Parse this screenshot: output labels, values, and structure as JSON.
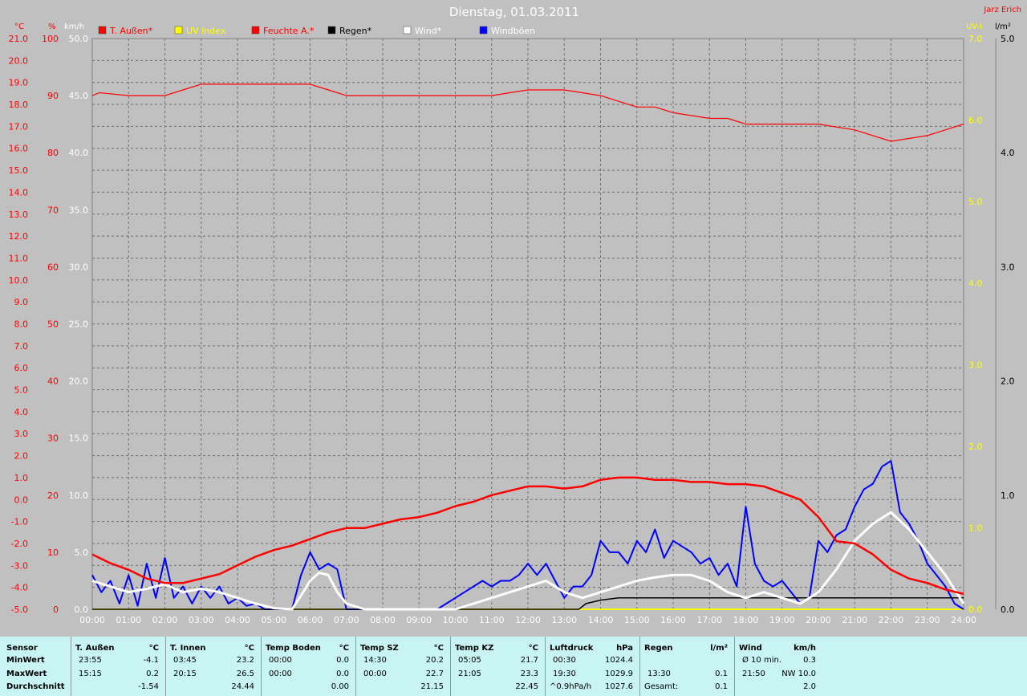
{
  "title": "Dienstag, 01.03.2011",
  "author": "Jarz Erich",
  "colors": {
    "red": "#ff0000",
    "darkred": "#dd0000",
    "yellow": "#ffff00",
    "black": "#000000",
    "white": "#ffffff",
    "blue": "#0000ff",
    "bg": "#c0c0c0",
    "grid": "#707070",
    "stats_bg": "#c8f4f4"
  },
  "axis_units": {
    "temp": "°C",
    "hum": "%",
    "wind": "km/h",
    "uv": "UV-I",
    "rain": "l/m²"
  },
  "axis_ticks": {
    "temp": [
      "21.0",
      "20.0",
      "19.0",
      "18.0",
      "17.0",
      "16.0",
      "15.0",
      "14.0",
      "13.0",
      "12.0",
      "11.0",
      "10.0",
      "9.0",
      "8.0",
      "7.0",
      "6.0",
      "5.0",
      "4.0",
      "3.0",
      "2.0",
      "1.0",
      "0.0",
      "-1.0",
      "-2.0",
      "-3.0",
      "-4.0",
      "-5.0"
    ],
    "hum": [
      "100",
      "90",
      "80",
      "70",
      "60",
      "50",
      "40",
      "30",
      "20",
      "10",
      "0"
    ],
    "wind": [
      "50.0",
      "45.0",
      "40.0",
      "35.0",
      "30.0",
      "25.0",
      "20.0",
      "15.0",
      "10.0",
      "5.0",
      "0.0"
    ],
    "uv": [
      "7.0",
      "6.0",
      "5.0",
      "4.0",
      "3.0",
      "2.0",
      "1.0",
      "0.0"
    ],
    "rain": [
      "5.0",
      "4.0",
      "3.0",
      "2.0",
      "1.0",
      "0.0"
    ],
    "time": [
      "00:00",
      "01:00",
      "02:00",
      "03:00",
      "04:00",
      "05:00",
      "06:00",
      "07:00",
      "08:00",
      "09:00",
      "10:00",
      "11:00",
      "12:00",
      "13:00",
      "14:00",
      "15:00",
      "16:00",
      "17:00",
      "18:00",
      "19:00",
      "20:00",
      "21:00",
      "22:00",
      "23:00",
      "24:00"
    ]
  },
  "chart_data": {
    "type": "line",
    "title": "Dienstag, 01.03.2011",
    "x_unit": "hours",
    "xlim": [
      0,
      24
    ],
    "ylim_temp": [
      -5,
      21
    ],
    "ylim_hum": [
      0,
      100
    ],
    "ylim_wind": [
      0,
      50
    ],
    "ylim_uv": [
      0,
      7
    ],
    "ylim_rain": [
      0,
      5
    ],
    "grid": true,
    "legend_position": "top",
    "series": [
      {
        "name": "T. Außen*",
        "color": "#ff0000",
        "axis": "temp",
        "x": [
          0,
          0.5,
          1,
          1.5,
          2,
          2.5,
          3,
          3.5,
          4,
          4.5,
          5,
          5.5,
          6,
          6.5,
          7,
          7.5,
          8,
          8.5,
          9,
          9.5,
          10,
          10.5,
          11,
          11.5,
          12,
          12.5,
          13,
          13.5,
          14,
          14.5,
          15,
          15.5,
          16,
          16.5,
          17,
          17.5,
          18,
          18.5,
          19,
          19.5,
          20,
          20.5,
          21,
          21.5,
          22,
          22.5,
          23,
          23.5,
          24
        ],
        "values": [
          -2.5,
          -2.9,
          -3.2,
          -3.6,
          -3.8,
          -3.8,
          -3.6,
          -3.4,
          -3.0,
          -2.6,
          -2.3,
          -2.1,
          -1.8,
          -1.5,
          -1.3,
          -1.3,
          -1.1,
          -0.9,
          -0.8,
          -0.6,
          -0.3,
          -0.1,
          0.2,
          0.4,
          0.6,
          0.6,
          0.5,
          0.6,
          0.9,
          1.0,
          1.0,
          0.9,
          0.9,
          0.8,
          0.8,
          0.7,
          0.7,
          0.6,
          0.3,
          0.0,
          -0.8,
          -1.9,
          -2.0,
          -2.5,
          -3.2,
          -3.6,
          -3.8,
          -4.1,
          -4.3
        ]
      },
      {
        "name": "Feuchte A.*",
        "color": "#ff0000",
        "axis": "hum",
        "x": [
          0,
          0.2,
          1,
          2,
          2.5,
          3,
          4,
          5,
          6,
          6.5,
          7,
          8,
          9,
          10,
          11,
          11.5,
          12,
          13,
          14,
          15,
          15.5,
          16,
          17,
          17.5,
          18,
          19,
          19.5,
          20,
          21,
          21.5,
          22,
          23,
          24
        ],
        "values": [
          90,
          90.5,
          90,
          90,
          91,
          92,
          92,
          92,
          92,
          91,
          90,
          90,
          90,
          90,
          90,
          90.5,
          91,
          91,
          90,
          88,
          88,
          87,
          86,
          86,
          85,
          85,
          85,
          85,
          84,
          83,
          82,
          83,
          85
        ]
      },
      {
        "name": "UV Index",
        "color": "#ffff00",
        "axis": "uv",
        "x": [
          0,
          24
        ],
        "values": [
          0.0,
          0.0
        ]
      },
      {
        "name": "Regen*",
        "color": "#000000",
        "axis": "rain",
        "x": [
          0,
          13.4,
          13.6,
          14,
          14.5,
          15,
          24
        ],
        "values": [
          0,
          0,
          0.05,
          0.08,
          0.1,
          0.1,
          0.1
        ]
      },
      {
        "name": "Wind*",
        "color": "#ffffff",
        "axis": "wind",
        "x": [
          0,
          0.5,
          1,
          1.5,
          2,
          2.5,
          3,
          3.5,
          4,
          4.5,
          5,
          5.5,
          5.75,
          6,
          6.25,
          6.5,
          6.75,
          7,
          7.5,
          8,
          9,
          10,
          10.5,
          11,
          11.5,
          12,
          12.5,
          13,
          13.5,
          14,
          14.5,
          15,
          15.5,
          16,
          16.5,
          17,
          17.5,
          18,
          18.5,
          19,
          19.5,
          20,
          20.5,
          21,
          21.5,
          22,
          22.5,
          23,
          23.5,
          24
        ],
        "values": [
          2.5,
          2.0,
          1.5,
          1.8,
          2.2,
          1.5,
          1.8,
          1.5,
          1.0,
          0.5,
          0.1,
          0.0,
          1.2,
          2.5,
          3.2,
          3.0,
          1.5,
          0.5,
          0.0,
          0.0,
          0.0,
          0.0,
          0.5,
          1.0,
          1.5,
          2.0,
          2.5,
          1.5,
          1.0,
          1.5,
          2.0,
          2.5,
          2.8,
          3.0,
          3.0,
          2.5,
          1.5,
          1.0,
          1.5,
          1.0,
          0.5,
          1.5,
          3.5,
          6.0,
          7.5,
          8.5,
          7.0,
          5.0,
          3.0,
          0.5
        ]
      },
      {
        "name": "Windböen",
        "color": "#0000ff",
        "axis": "wind",
        "x": [
          0,
          0.25,
          0.5,
          0.75,
          1,
          1.25,
          1.5,
          1.75,
          2,
          2.25,
          2.5,
          2.75,
          3,
          3.25,
          3.5,
          3.75,
          4,
          4.25,
          4.5,
          4.75,
          5,
          5.25,
          5.5,
          5.75,
          6,
          6.25,
          6.5,
          6.75,
          7,
          7.5,
          8,
          8.5,
          9,
          9.5,
          10,
          10.25,
          10.5,
          10.75,
          11,
          11.25,
          11.5,
          11.75,
          12,
          12.25,
          12.5,
          12.75,
          13,
          13.25,
          13.5,
          13.75,
          14,
          14.25,
          14.5,
          14.75,
          15,
          15.25,
          15.5,
          15.75,
          16,
          16.25,
          16.5,
          16.75,
          17,
          17.25,
          17.5,
          17.75,
          18,
          18.25,
          18.5,
          18.75,
          19,
          19.25,
          19.5,
          19.75,
          20,
          20.25,
          20.5,
          20.75,
          21,
          21.25,
          21.5,
          21.75,
          22,
          22.25,
          22.5,
          22.75,
          23,
          23.25,
          23.5,
          23.75,
          24
        ],
        "values": [
          3,
          1.5,
          2.5,
          0.5,
          3,
          0.3,
          4,
          1,
          4.5,
          1,
          2,
          0.5,
          2,
          1,
          2,
          0.5,
          1,
          0.3,
          0.5,
          0,
          0,
          0,
          0,
          3,
          5,
          3.5,
          4,
          3.5,
          0,
          0,
          0,
          0,
          0,
          0,
          1,
          1.5,
          2,
          2.5,
          2,
          2.5,
          2.5,
          3,
          4,
          3,
          4,
          2.5,
          1,
          2,
          2,
          3,
          6,
          5,
          5,
          4,
          6,
          5,
          7,
          4.5,
          6,
          5.5,
          5,
          4,
          4.5,
          3,
          4,
          2,
          9,
          4,
          2.5,
          2,
          2.5,
          1.5,
          0.5,
          1,
          6,
          5,
          6.5,
          7,
          9,
          10.5,
          11,
          12.5,
          13,
          8.5,
          7.5,
          6,
          4,
          3,
          2,
          0.5,
          0
        ]
      }
    ]
  },
  "legend": [
    {
      "label": "T. Außen*",
      "color": "#ff0000",
      "text_color": "#ff0000"
    },
    {
      "label": "UV Index",
      "color": "#ffff00",
      "text_color": "#ffff00"
    },
    {
      "label": "Feuchte A.*",
      "color": "#ff0000",
      "text_color": "#ff0000"
    },
    {
      "label": "Regen*",
      "color": "#000000",
      "text_color": "#000000"
    },
    {
      "label": "Wind*",
      "color": "#ffffff",
      "text_color": "#ffffff"
    },
    {
      "label": "Windböen",
      "color": "#0000ff",
      "text_color": "#ffffff"
    }
  ],
  "stats": {
    "sensor": {
      "header": "Sensor",
      "rows": [
        "MinWert",
        "MaxWert",
        "Durchschnitt"
      ]
    },
    "columns": [
      {
        "name": "T. Außen",
        "unit": "°C",
        "min_time": "23:55",
        "min_val": "-4.1",
        "max_time": "15:15",
        "max_val": "0.2",
        "avg": "-1.54"
      },
      {
        "name": "T. Innen",
        "unit": "°C",
        "min_time": "03:45",
        "min_val": "23.2",
        "max_time": "20:15",
        "max_val": "26.5",
        "avg": "24.44"
      },
      {
        "name": "Temp Boden",
        "unit": "°C",
        "min_time": "00:00",
        "min_val": "0.0",
        "max_time": "00:00",
        "max_val": "0.0",
        "avg": "0.00"
      },
      {
        "name": "Temp SZ",
        "unit": "°C",
        "min_time": "14:30",
        "min_val": "20.2",
        "max_time": "00:00",
        "max_val": "22.7",
        "avg": "21.15"
      },
      {
        "name": "Temp KZ",
        "unit": "°C",
        "min_time": "05:05",
        "min_val": "21.7",
        "max_time": "21:05",
        "max_val": "23.3",
        "avg": "22.45"
      },
      {
        "name": "Luftdruck",
        "unit": "hPa",
        "min_time": "00:30",
        "min_val": "1024.4",
        "max_time": "19:30",
        "max_val": "1029.9",
        "avg_label": "^0.9hPa/h",
        "avg": "1027.6"
      },
      {
        "name": "Regen",
        "unit": "l/m²",
        "min_time": "",
        "min_val": "",
        "max_time": "13:30",
        "max_val": "0.1",
        "avg_label": "Gesamt:",
        "avg": "0.1"
      },
      {
        "name": "Wind",
        "unit": "km/h",
        "min_time": "Ø 10 min.",
        "min_val": "0.3",
        "max_time": "21:50",
        "max_val": "NW 10.0",
        "avg": "2.0"
      }
    ]
  }
}
